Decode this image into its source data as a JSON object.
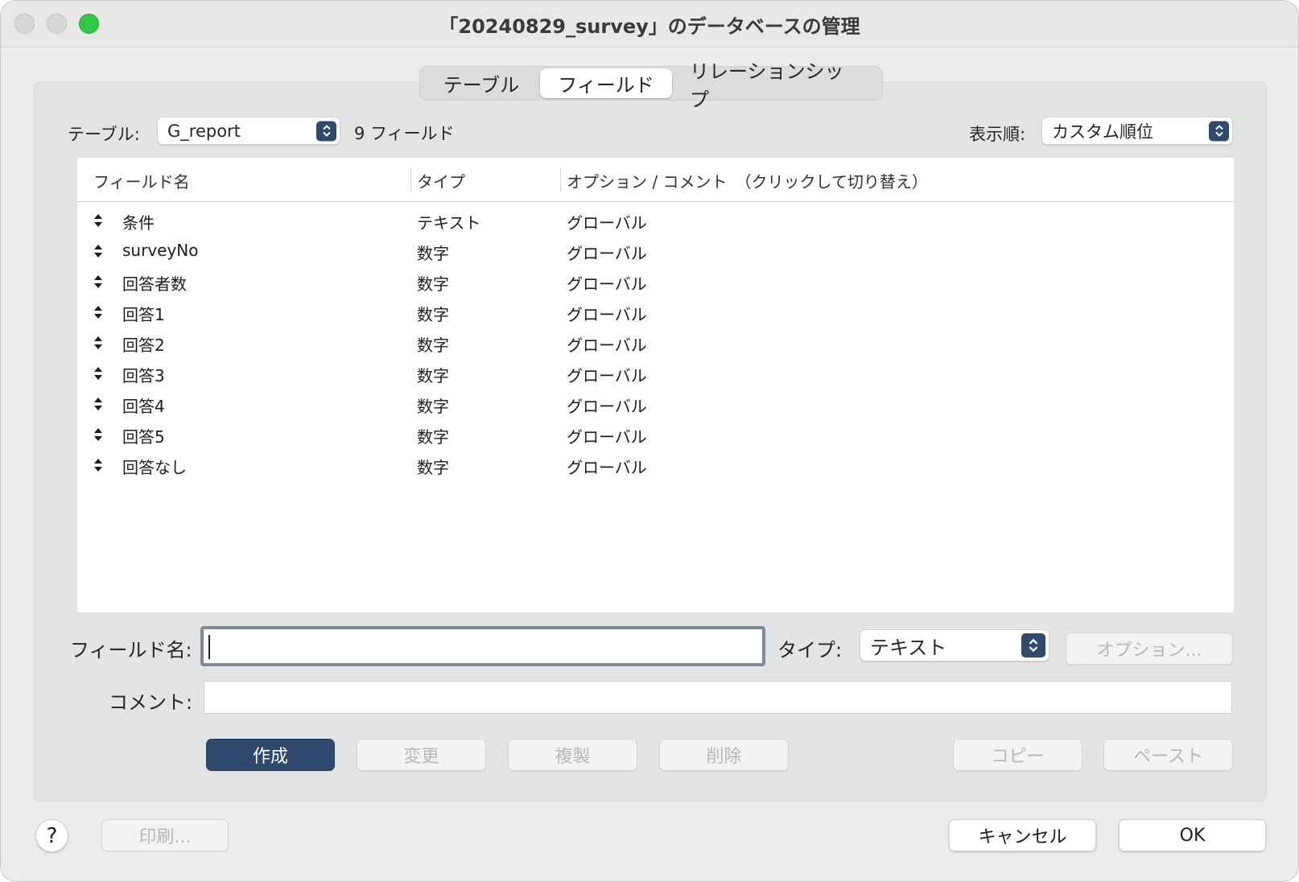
{
  "window": {
    "title": "「20240829_survey」のデータベースの管理"
  },
  "tabs": [
    {
      "label": "テーブル",
      "selected": false
    },
    {
      "label": "フィールド",
      "selected": true
    },
    {
      "label": "リレーションシップ",
      "selected": false
    }
  ],
  "table_selector": {
    "label": "テーブル:",
    "value": "G_report",
    "count": "9 フィールド"
  },
  "sort": {
    "label": "表示順:",
    "value": "カスタム順位"
  },
  "columns": {
    "name": "フィールド名",
    "type": "タイプ",
    "options": "オプション / コメント　（クリックして切り替え）"
  },
  "rows": [
    {
      "name": "条件",
      "type": "テキスト",
      "options": "グローバル"
    },
    {
      "name": "surveyNo",
      "type": "数字",
      "options": "グローバル"
    },
    {
      "name": "回答者数",
      "type": "数字",
      "options": "グローバル"
    },
    {
      "name": "回答1",
      "type": "数字",
      "options": "グローバル"
    },
    {
      "name": "回答2",
      "type": "数字",
      "options": "グローバル"
    },
    {
      "name": "回答3",
      "type": "数字",
      "options": "グローバル"
    },
    {
      "name": "回答4",
      "type": "数字",
      "options": "グローバル"
    },
    {
      "name": "回答5",
      "type": "数字",
      "options": "グローバル"
    },
    {
      "name": "回答なし",
      "type": "数字",
      "options": "グローバル"
    }
  ],
  "form": {
    "field_name_label": "フィールド名:",
    "field_name_value": "",
    "type_label": "タイプ:",
    "type_value": "テキスト",
    "options_button": "オプション...",
    "comment_label": "コメント:",
    "comment_value": ""
  },
  "actions": {
    "create": "作成",
    "change": "変更",
    "duplicate": "複製",
    "delete": "削除",
    "copy": "コピー",
    "paste": "ペースト"
  },
  "footer": {
    "help": "?",
    "print": "印刷...",
    "cancel": "キャンセル",
    "ok": "OK"
  },
  "colors": {
    "accent": "#2d4a6e",
    "close_zoom_green": "#35c648"
  }
}
